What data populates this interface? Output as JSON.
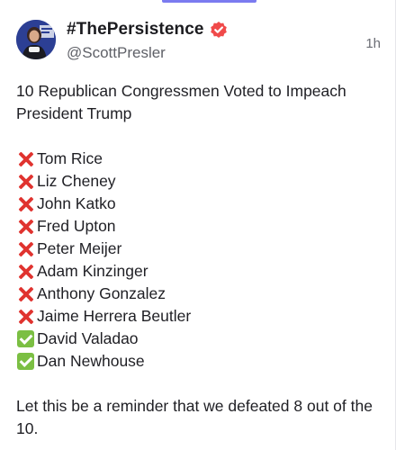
{
  "post": {
    "author": {
      "display_name": "#ThePersistence",
      "handle": "@ScottPresler",
      "verified_icon": "verified-badge-icon",
      "avatar_icon": "avatar-photo"
    },
    "timestamp": "1h",
    "intro": "10 Republican Congressmen Voted to Impeach President Trump",
    "names": [
      {
        "mark": "cross-mark-icon",
        "name": "Tom Rice"
      },
      {
        "mark": "cross-mark-icon",
        "name": "Liz Cheney"
      },
      {
        "mark": "cross-mark-icon",
        "name": "John Katko"
      },
      {
        "mark": "cross-mark-icon",
        "name": "Fred Upton"
      },
      {
        "mark": "cross-mark-icon",
        "name": "Peter Meijer"
      },
      {
        "mark": "cross-mark-icon",
        "name": "Adam Kinzinger"
      },
      {
        "mark": "cross-mark-icon",
        "name": "Anthony Gonzalez"
      },
      {
        "mark": "cross-mark-icon",
        "name": "Jaime Herrera Beutler"
      },
      {
        "mark": "check-mark-icon",
        "name": "David Valadao"
      },
      {
        "mark": "check-mark-icon",
        "name": "Dan Newhouse"
      }
    ],
    "outro": "Let this be a reminder that we defeated 8 out of the 10."
  },
  "colors": {
    "cross": "#e0332f",
    "check": "#7bbf43",
    "verified": "#f04a4a",
    "accent": "#7b7bf0"
  }
}
